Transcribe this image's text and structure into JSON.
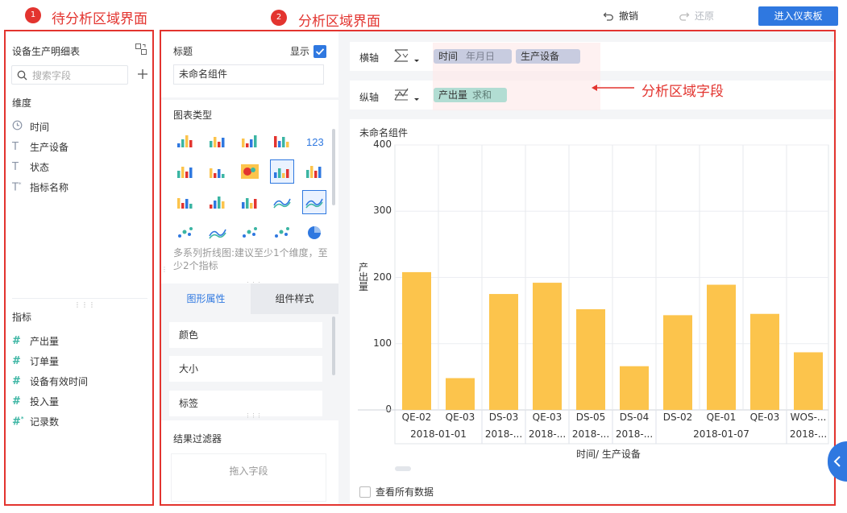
{
  "annotations": {
    "badge1": "1",
    "title1": "待分析区域界面",
    "badge2": "2",
    "title2": "分析区域界面",
    "fields_note": "分析区域字段"
  },
  "toolbar": {
    "undo": "撤销",
    "redo": "还原",
    "enter_dashboard": "进入仪表板"
  },
  "left_panel": {
    "table_name": "设备生产明细表",
    "search_placeholder": "搜索字段",
    "dimension_header": "维度",
    "dimensions": [
      {
        "icon": "clock-icon",
        "label": "时间"
      },
      {
        "icon": "text-t-icon",
        "label": "生产设备"
      },
      {
        "icon": "text-t-icon",
        "label": "状态"
      },
      {
        "icon": "text-t-star-icon",
        "label": "指标名称"
      }
    ],
    "measure_header": "指标",
    "measures": [
      {
        "icon": "hash-icon",
        "label": "产出量"
      },
      {
        "icon": "hash-icon",
        "label": "订单量"
      },
      {
        "icon": "hash-icon",
        "label": "设备有效时间"
      },
      {
        "icon": "hash-icon",
        "label": "投入量"
      },
      {
        "icon": "hash-star-icon",
        "label": "记录数"
      }
    ]
  },
  "middle_panel": {
    "title_label": "标题",
    "show_label": "显示",
    "title_value": "未命名组件",
    "chart_type_label": "图表类型",
    "chart_hint": "多系列折线图:建议至少1个维度，至少2个指标",
    "tab_graphic": "图形属性",
    "tab_component": "组件样式",
    "props": [
      "颜色",
      "大小",
      "标签"
    ],
    "filter_label": "结果过滤器",
    "drop_field": "拖入字段"
  },
  "axes": {
    "x_label": "横轴",
    "y_label": "纵轴",
    "x_pills": [
      {
        "name": "时间",
        "sub": "年月日"
      },
      {
        "name": "生产设备",
        "sub": ""
      }
    ],
    "y_pills": [
      {
        "name": "产出量",
        "sub": "求和"
      }
    ]
  },
  "chart_data": {
    "type": "bar",
    "title": "未命名组件",
    "xlabel": "时间/ 生产设备",
    "ylabel": "产出量",
    "ylim": [
      0,
      400
    ],
    "yticks": [
      "400",
      "300",
      "200",
      "100",
      "0"
    ],
    "categories": [
      "QE-02",
      "QE-03",
      "DS-03",
      "QE-03",
      "DS-05",
      "DS-04",
      "DS-02",
      "QE-01",
      "QE-03",
      "WOS-..."
    ],
    "values": [
      208,
      48,
      175,
      192,
      152,
      66,
      143,
      189,
      145,
      87
    ],
    "date_groups": [
      {
        "label": "2018-01-01",
        "span": 2
      },
      {
        "label": "2018-...",
        "span": 1
      },
      {
        "label": "2018-...",
        "span": 1
      },
      {
        "label": "2018-...",
        "span": 1
      },
      {
        "label": "2018-...",
        "span": 1
      },
      {
        "label": "2018-01-07",
        "span": 3
      },
      {
        "label": "2018-...",
        "span": 1
      }
    ],
    "bar_color": "#fcc44c"
  },
  "footer": {
    "view_all": "查看所有数据"
  },
  "colors": {
    "accent": "#2f78e0",
    "annotation": "#e3342f",
    "bar": "#fcc44c"
  }
}
